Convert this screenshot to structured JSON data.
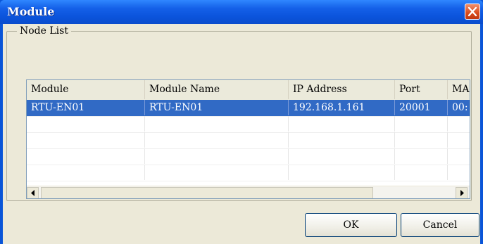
{
  "window": {
    "title": "Module"
  },
  "node_list": {
    "label": "Node List",
    "columns": [
      "Module",
      "Module Name",
      "IP Address",
      "Port",
      "MA"
    ],
    "rows": [
      [
        "RTU-EN01",
        "RTU-EN01",
        "192.168.1.161",
        "20001",
        "00:"
      ]
    ]
  },
  "buttons": {
    "ok_label": "OK",
    "cancel_label": "Cancel"
  },
  "icons": {
    "close": "close-icon",
    "scroll_left": "arrow-left-icon",
    "scroll_right": "arrow-right-icon"
  },
  "colors": {
    "selection": "#316ac5",
    "close_button": "#d84a1c",
    "titlebar": "#0b54dc"
  }
}
